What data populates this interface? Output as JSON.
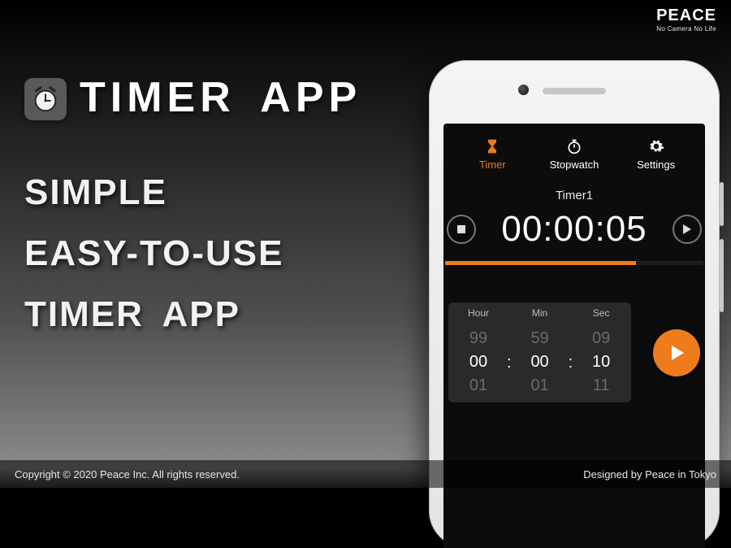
{
  "brand": {
    "name": "PEACE",
    "tagline": "No Camera No Life"
  },
  "title": "TIMER  APP",
  "slogan": {
    "line1": "SIMPLE",
    "line2": "EASY-TO-USE",
    "line3": "TIMER  APP"
  },
  "footer": {
    "copyright": "Copyright © 2020 Peace Inc. All rights reserved.",
    "designed": "Designed by Peace in Tokyo"
  },
  "colors": {
    "accent": "#ee7b1c"
  },
  "app": {
    "tabs": {
      "timer": "Timer",
      "stopwatch": "Stopwatch",
      "settings": "Settings",
      "active": "timer"
    },
    "timer_name": "Timer1",
    "elapsed_display": "00:00:05",
    "progress_percent": 74,
    "picker": {
      "labels": {
        "hour": "Hour",
        "min": "Min",
        "sec": "Sec"
      },
      "hour": {
        "above": "99",
        "selected": "00",
        "below": "01"
      },
      "minute": {
        "above": "59",
        "selected": "00",
        "below": "01"
      },
      "second": {
        "above": "09",
        "selected": "10",
        "below": "11"
      }
    }
  }
}
